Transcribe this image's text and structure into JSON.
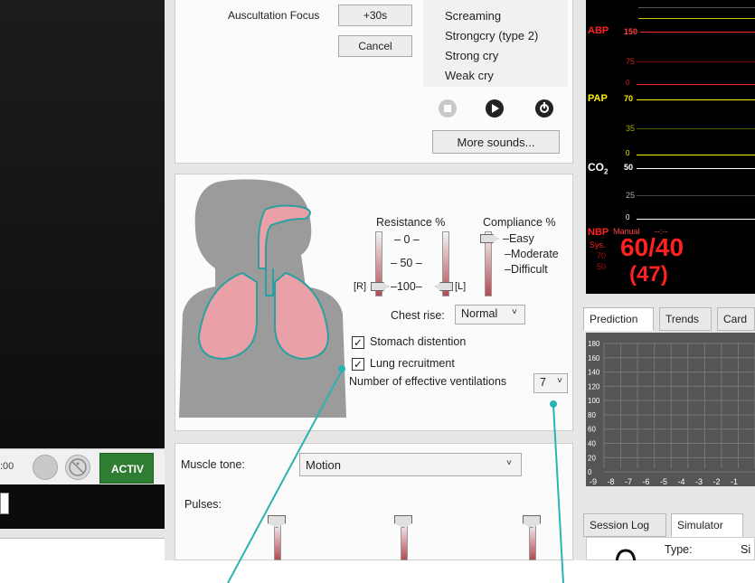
{
  "auscultation": {
    "label": "Auscultation Focus",
    "time_button": "+30s",
    "cancel_button": "Cancel",
    "sounds": [
      "Screaming",
      "Strongcry (type 2)",
      "Strong cry",
      "Weak cry"
    ],
    "more_sounds_button": "More sounds..."
  },
  "airway": {
    "resistance_label": "Resistance %",
    "compliance_label": "Compliance %",
    "resistance_ticks": [
      "0",
      "50",
      "100"
    ],
    "left_side_label": "[R]",
    "right_side_label": "[L]",
    "compliance_options": [
      "Easy",
      "Moderate",
      "Difficult"
    ],
    "chest_rise_label": "Chest rise:",
    "chest_rise_value": "Normal",
    "stomach_distention_label": "Stomach distention",
    "stomach_distention_checked": true,
    "lung_recruitment_label": "Lung recruitment",
    "lung_recruitment_checked": true,
    "effective_ventilations_label": "Number of effective ventilations",
    "effective_ventilations_value": "7"
  },
  "muscle": {
    "muscle_tone_label": "Muscle tone:",
    "muscle_tone_value": "Motion",
    "pulses_label": "Pulses:"
  },
  "left_panel": {
    "time_fragment": ":00",
    "activate_button": "ACTIV"
  },
  "monitor": {
    "abp_label": "ABP",
    "abp_scale": [
      "150",
      "75",
      "0"
    ],
    "pap_label": "PAP",
    "pap_scale": [
      "70",
      "35",
      "0"
    ],
    "co2_label": "CO",
    "co2_sub": "2",
    "co2_scale": [
      "50",
      "25",
      "0"
    ],
    "nbp_label": "NBP",
    "nbp_mode": "Manual",
    "nbp_time": "--:--",
    "sys_label": "Sys.",
    "sys_hi": "70",
    "sys_lo": "50",
    "nbp_value": "60/40",
    "nbp_mean": "(47)",
    "colors": {
      "abp": "#ff2020",
      "pap": "#ffee00",
      "co2": "#ffffff"
    }
  },
  "tabs_top": [
    "Prediction",
    "Trends",
    "Card"
  ],
  "prediction_chart": {
    "y_ticks": [
      "180",
      "160",
      "140",
      "120",
      "100",
      "80",
      "60",
      "40",
      "20",
      "0"
    ],
    "x_ticks": [
      "-9",
      "-8",
      "-7",
      "-6",
      "-5",
      "-4",
      "-3",
      "-2",
      "-1"
    ]
  },
  "tabs_bottom": [
    "Session Log",
    "Simulator"
  ],
  "simulator_panel": {
    "type_label": "Type:",
    "type_value": "Si"
  }
}
